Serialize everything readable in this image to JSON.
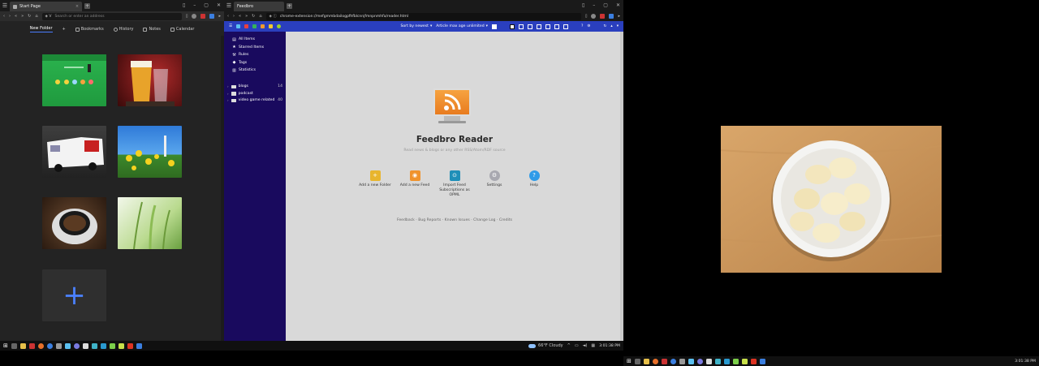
{
  "left_window": {
    "tab_title": "Start Page",
    "address_placeholder": "Search or enter an address",
    "nav": [
      {
        "label": "New Folder",
        "icon": "folder-icon"
      },
      {
        "label": "+",
        "icon": "add-icon"
      },
      {
        "label": "Bookmarks",
        "icon": "bookmark-icon"
      },
      {
        "label": "History",
        "icon": "clock-icon"
      },
      {
        "label": "Notes",
        "icon": "notes-icon"
      },
      {
        "label": "Calendar",
        "icon": "calendar-icon"
      }
    ],
    "speed_dials": [
      {
        "name": "green-website-thumb"
      },
      {
        "name": "beer-glass-thumb"
      },
      {
        "name": "youtube-van-thumb"
      },
      {
        "name": "yellow-flowers-thumb"
      },
      {
        "name": "coffee-cup-thumb"
      },
      {
        "name": "grass-thumb"
      },
      {
        "name": "add-speed-dial"
      }
    ],
    "add_glyph": "+"
  },
  "right_browser": {
    "tab_title": "Feedbro",
    "address": "chrome-extension://mefgmmbdailogpfhfblcnnjfmnpnmhfa/reader.html",
    "toolbar": {
      "sort_label": "Sort by newest",
      "age_label": "Article max age unlimited"
    },
    "sidebar": {
      "nav": [
        {
          "label": "All Items",
          "icon": "list-icon",
          "glyph": "▤"
        },
        {
          "label": "Starred Items",
          "icon": "star-icon",
          "glyph": "★"
        },
        {
          "label": "Rules",
          "icon": "wrench-icon",
          "glyph": "⚒"
        },
        {
          "label": "Tags",
          "icon": "tag-icon",
          "glyph": "◆"
        },
        {
          "label": "Statistics",
          "icon": "chart-icon",
          "glyph": "▥"
        }
      ],
      "folders": [
        {
          "label": "blogs",
          "count": "14"
        },
        {
          "label": "podcast",
          "count": ""
        },
        {
          "label": "video game related",
          "count": "40"
        }
      ]
    },
    "main": {
      "title": "Feedbro Reader",
      "subtitle": "Read news & blogs or any other RSS/Atom/RDF source",
      "actions": [
        {
          "label": "Add a new Folder",
          "icon": "add-folder-icon",
          "color": "#e8b52e",
          "glyph": "+"
        },
        {
          "label": "Add a new Feed",
          "icon": "add-feed-icon",
          "color": "#f0932c",
          "glyph": "◉"
        },
        {
          "label": "Import Feed Subscriptions as OPML",
          "icon": "import-opml-icon",
          "color": "#1f8fb8",
          "glyph": "⊙"
        },
        {
          "label": "Settings",
          "icon": "settings-icon",
          "color": "#a8a8b0",
          "glyph": "⚙"
        },
        {
          "label": "Help",
          "icon": "help-icon",
          "color": "#2f9be8",
          "glyph": "?"
        }
      ],
      "links": "Feedback · Bug Reports · Known Issues · Change Log · Credits"
    }
  },
  "taskbar": {
    "weather": "66°F  Cloudy",
    "clock": "3:01:38 PM"
  }
}
